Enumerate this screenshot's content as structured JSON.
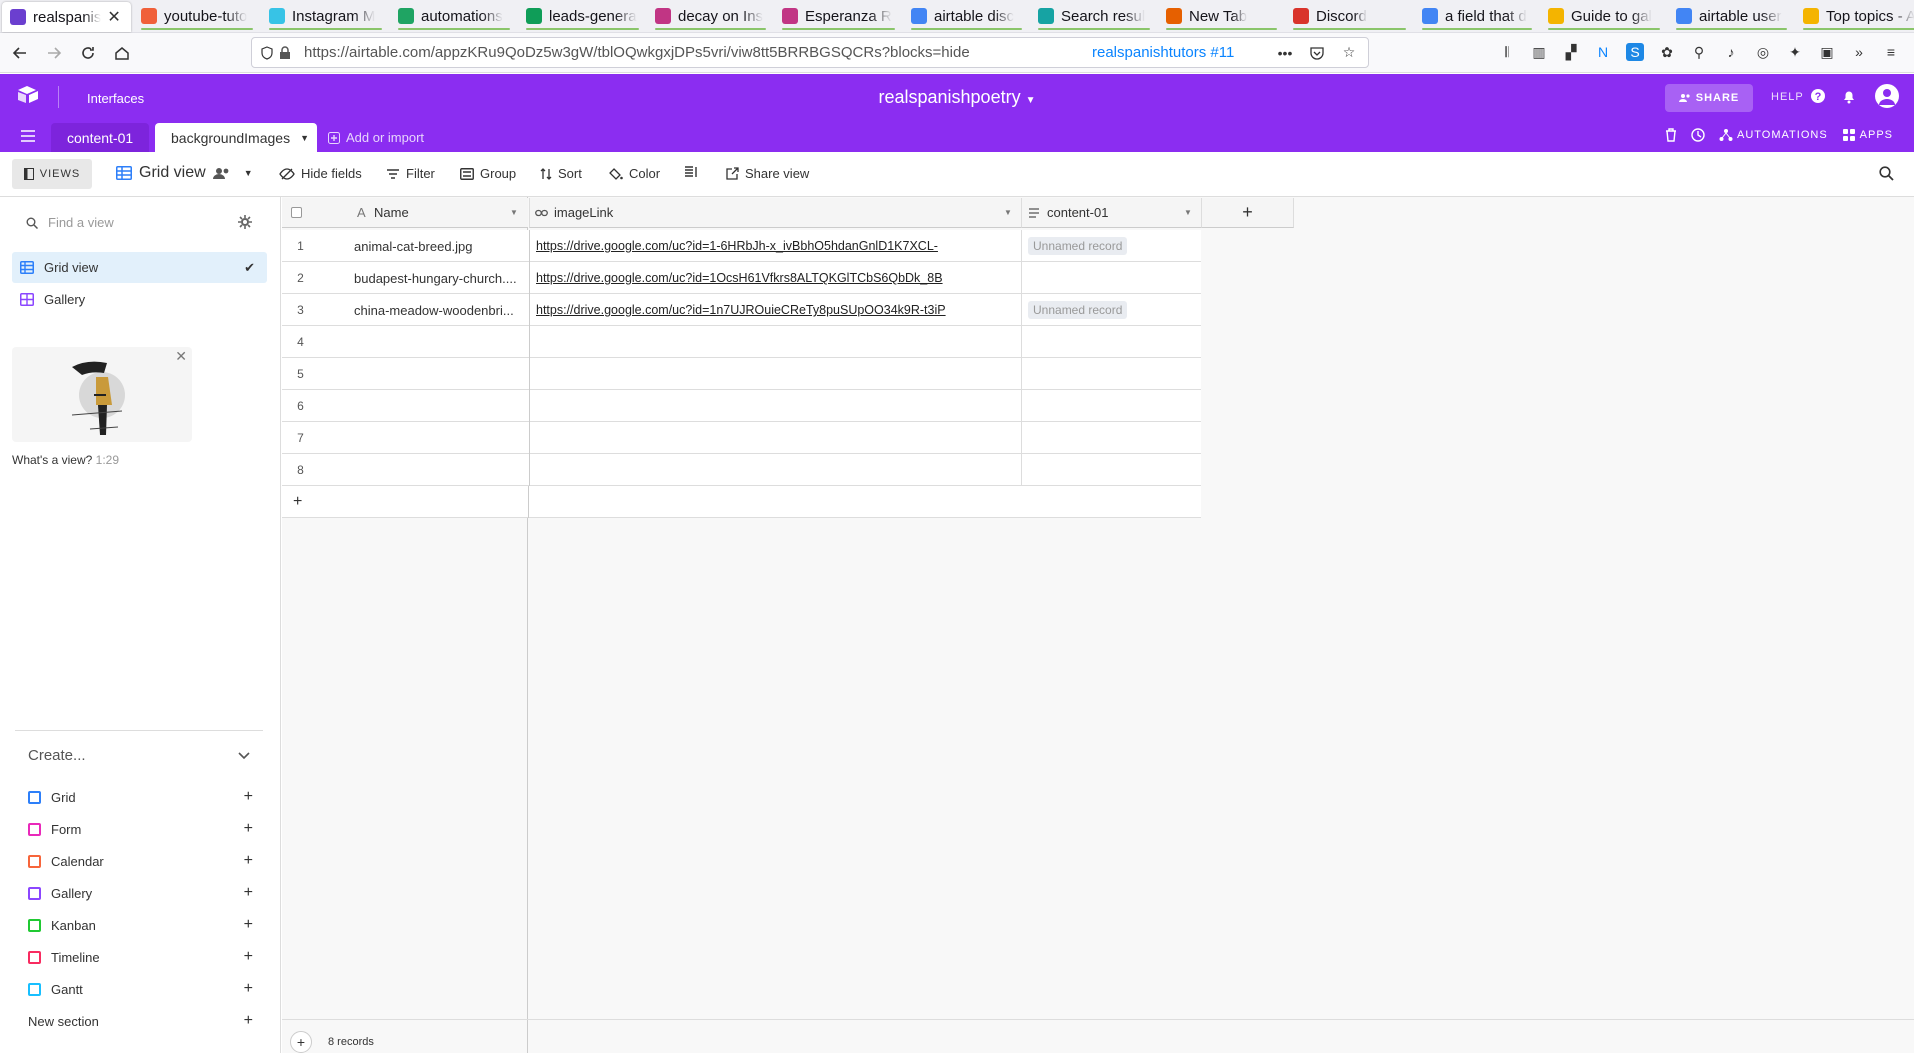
{
  "browser": {
    "tabs": [
      {
        "title": "realspanis",
        "color": "#6b3fcf",
        "active": true
      },
      {
        "title": "youtube-tuto",
        "color": "#f0603a"
      },
      {
        "title": "Instagram M",
        "color": "#37c3e6"
      },
      {
        "title": "automations",
        "color": "#1fa463"
      },
      {
        "title": "leads-genera",
        "color": "#0f9d58"
      },
      {
        "title": "decay on Ins",
        "color": "#c13584"
      },
      {
        "title": "Esperanza R",
        "color": "#c13584"
      },
      {
        "title": "airtable disc",
        "color": "#4285f4"
      },
      {
        "title": "Search resul",
        "color": "#16a3a3"
      },
      {
        "title": "New Tab",
        "color": "#e66000"
      },
      {
        "title": "Discord",
        "color": "#d9342b"
      },
      {
        "title": "a field that d",
        "color": "#4285f4"
      },
      {
        "title": "Guide to gal",
        "color": "#f4b400"
      },
      {
        "title": "airtable user",
        "color": "#4285f4"
      },
      {
        "title": "Top topics - A",
        "color": "#f4b400"
      }
    ],
    "url": "https://airtable.com/appzKRu9QoDz5w3gW/tblOQwkgxjDPs5vri/viw8tt5BRRBGSQCRs?blocks=hide",
    "url_host": "airtable.com",
    "site_label": "realspanishtutors #11"
  },
  "header": {
    "interfaces": "Interfaces",
    "base_name": "realspanishpoetry",
    "share": "SHARE",
    "help": "HELP",
    "automations": "AUTOMATIONS",
    "apps": "APPS",
    "accent": "#8b2df1"
  },
  "tables": {
    "tab1": "content-01",
    "tab2": "backgroundImages",
    "add": "Add or import"
  },
  "toolbar": {
    "views": "VIEWS",
    "view_name": "Grid view",
    "hide_fields": "Hide fields",
    "filter": "Filter",
    "group": "Group",
    "sort": "Sort",
    "color": "Color",
    "share_view": "Share view"
  },
  "sidebar": {
    "find_placeholder": "Find a view",
    "views": [
      {
        "label": "Grid view",
        "selected": true
      },
      {
        "label": "Gallery"
      }
    ],
    "video_title": "What's a view?",
    "video_time": "1:29",
    "create": "Create...",
    "create_items": [
      {
        "label": "Grid",
        "color": "#2d7ff9"
      },
      {
        "label": "Form",
        "color": "#e929ba"
      },
      {
        "label": "Calendar",
        "color": "#f7653b"
      },
      {
        "label": "Gallery",
        "color": "#8b46ff"
      },
      {
        "label": "Kanban",
        "color": "#20c933"
      },
      {
        "label": "Timeline",
        "color": "#f82b60"
      },
      {
        "label": "Gantt",
        "color": "#18bfff"
      },
      {
        "label": "New section"
      }
    ]
  },
  "grid": {
    "columns": [
      "Name",
      "imageLink",
      "content-01"
    ],
    "rows": [
      {
        "n": "1",
        "name": "animal-cat-breed.jpg",
        "link": "https://drive.google.com/uc?id=1-6HRbJh-x_ivBbhO5hdanGnlD1K7XCL-",
        "content": "Unnamed record"
      },
      {
        "n": "2",
        "name": "budapest-hungary-church....",
        "link": "https://drive.google.com/uc?id=1OcsH61Vfkrs8ALTQKGlTCbS6QbDk_8B",
        "content": ""
      },
      {
        "n": "3",
        "name": "china-meadow-woodenbri...",
        "link": "https://drive.google.com/uc?id=1n7UJROuieCReTy8puSUpOO34k9R-t3iP",
        "content": "Unnamed record"
      },
      {
        "n": "4",
        "name": "",
        "link": "",
        "content": ""
      },
      {
        "n": "5",
        "name": "",
        "link": "",
        "content": ""
      },
      {
        "n": "6",
        "name": "",
        "link": "",
        "content": ""
      },
      {
        "n": "7",
        "name": "",
        "link": "",
        "content": ""
      },
      {
        "n": "8",
        "name": "",
        "link": "",
        "content": ""
      }
    ],
    "record_count": "8 records"
  }
}
